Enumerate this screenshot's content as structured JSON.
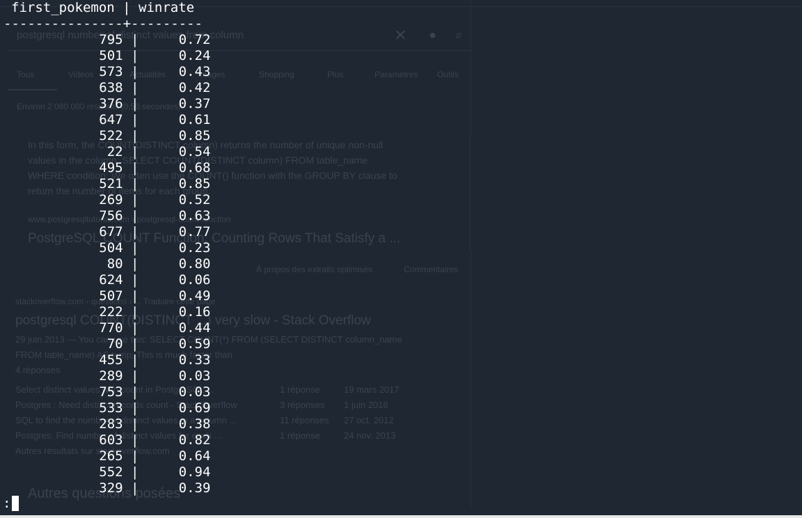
{
  "terminal": {
    "header_line": "first_pokemon | winrate",
    "separator_line": "---------------+---------",
    "prompt": ":",
    "columns": [
      "first_pokemon",
      "winrate"
    ],
    "rows": [
      {
        "first_pokemon": "795",
        "winrate": "0.72"
      },
      {
        "first_pokemon": "501",
        "winrate": "0.24"
      },
      {
        "first_pokemon": "573",
        "winrate": "0.43"
      },
      {
        "first_pokemon": "638",
        "winrate": "0.42"
      },
      {
        "first_pokemon": "376",
        "winrate": "0.37"
      },
      {
        "first_pokemon": "647",
        "winrate": "0.61"
      },
      {
        "first_pokemon": "522",
        "winrate": "0.85"
      },
      {
        "first_pokemon": "22",
        "winrate": "0.54"
      },
      {
        "first_pokemon": "495",
        "winrate": "0.68"
      },
      {
        "first_pokemon": "521",
        "winrate": "0.85"
      },
      {
        "first_pokemon": "269",
        "winrate": "0.52"
      },
      {
        "first_pokemon": "756",
        "winrate": "0.63"
      },
      {
        "first_pokemon": "677",
        "winrate": "0.77"
      },
      {
        "first_pokemon": "504",
        "winrate": "0.23"
      },
      {
        "first_pokemon": "80",
        "winrate": "0.80"
      },
      {
        "first_pokemon": "624",
        "winrate": "0.06"
      },
      {
        "first_pokemon": "507",
        "winrate": "0.49"
      },
      {
        "first_pokemon": "222",
        "winrate": "0.16"
      },
      {
        "first_pokemon": "770",
        "winrate": "0.44"
      },
      {
        "first_pokemon": "70",
        "winrate": "0.59"
      },
      {
        "first_pokemon": "455",
        "winrate": "0.33"
      },
      {
        "first_pokemon": "289",
        "winrate": "0.03"
      },
      {
        "first_pokemon": "753",
        "winrate": "0.03"
      },
      {
        "first_pokemon": "533",
        "winrate": "0.69"
      },
      {
        "first_pokemon": "283",
        "winrate": "0.38"
      },
      {
        "first_pokemon": "603",
        "winrate": "0.82"
      },
      {
        "first_pokemon": "265",
        "winrate": "0.64"
      },
      {
        "first_pokemon": "552",
        "winrate": "0.94"
      },
      {
        "first_pokemon": "329",
        "winrate": "0.39"
      }
    ]
  },
  "background_browser": {
    "search_query": "postgresql number of distinct values from column",
    "tabs": [
      "Tous",
      "Vidéos",
      "Actualités",
      "Images",
      "Shopping",
      "Plus",
      "Paramètres",
      "Outils"
    ],
    "result_stats": "Environ 2 080 000 résultats (0,50 secondes)",
    "snippet_lines": [
      "In this form, the COUNT(DISTINCT column) returns the number of unique non-null",
      "values in the column. SELECT COUNT(DISTINCT column) FROM table_name",
      "WHERE condition; We often use the COUNT() function with the GROUP BY clause to",
      "return the number of items for each group."
    ],
    "snippet_source_url": "www.postgresqltutorial.com › postgresql-count-function",
    "snippet_title": "PostgreSQL COUNT Function: Counting Rows That Satisfy a ...",
    "feedback_about": "À propos des extraits optimisés",
    "feedback_comments": "Commentaires",
    "result2_url": "stackoverflow.com › questions › ...   Traduire cette page",
    "result2_title": "postgresql COUNT(DISTINCT ...) very slow - Stack Overflow",
    "result2_line1": "29 juin 2013 — You can use this: SELECT COUNT(*) FROM (SELECT DISTINCT column_name",
    "result2_line2": "FROM table_name) AS temp;  This is much faster than",
    "result2_line3": "4 réponses",
    "sub_results": [
      {
        "title": "Select distinct values with count in PostgreSQL ...",
        "answers": "1 réponse",
        "date": "19 mars 2017"
      },
      {
        "title": "Postgres : Need distinct records count - Stack Overflow",
        "answers": "3 réponses",
        "date": "1 juin 2016"
      },
      {
        "title": "SQL to find the number of distinct values in a column ...",
        "answers": "11 réponses",
        "date": "27 oct. 2012"
      },
      {
        "title": "Postgres: Find number of distinct values for each ...",
        "answers": "1 réponse",
        "date": "24 nov. 2013"
      }
    ],
    "more_results": "Autres résultats sur stackoverflow.com",
    "related_questions": "Autres questions posées"
  }
}
